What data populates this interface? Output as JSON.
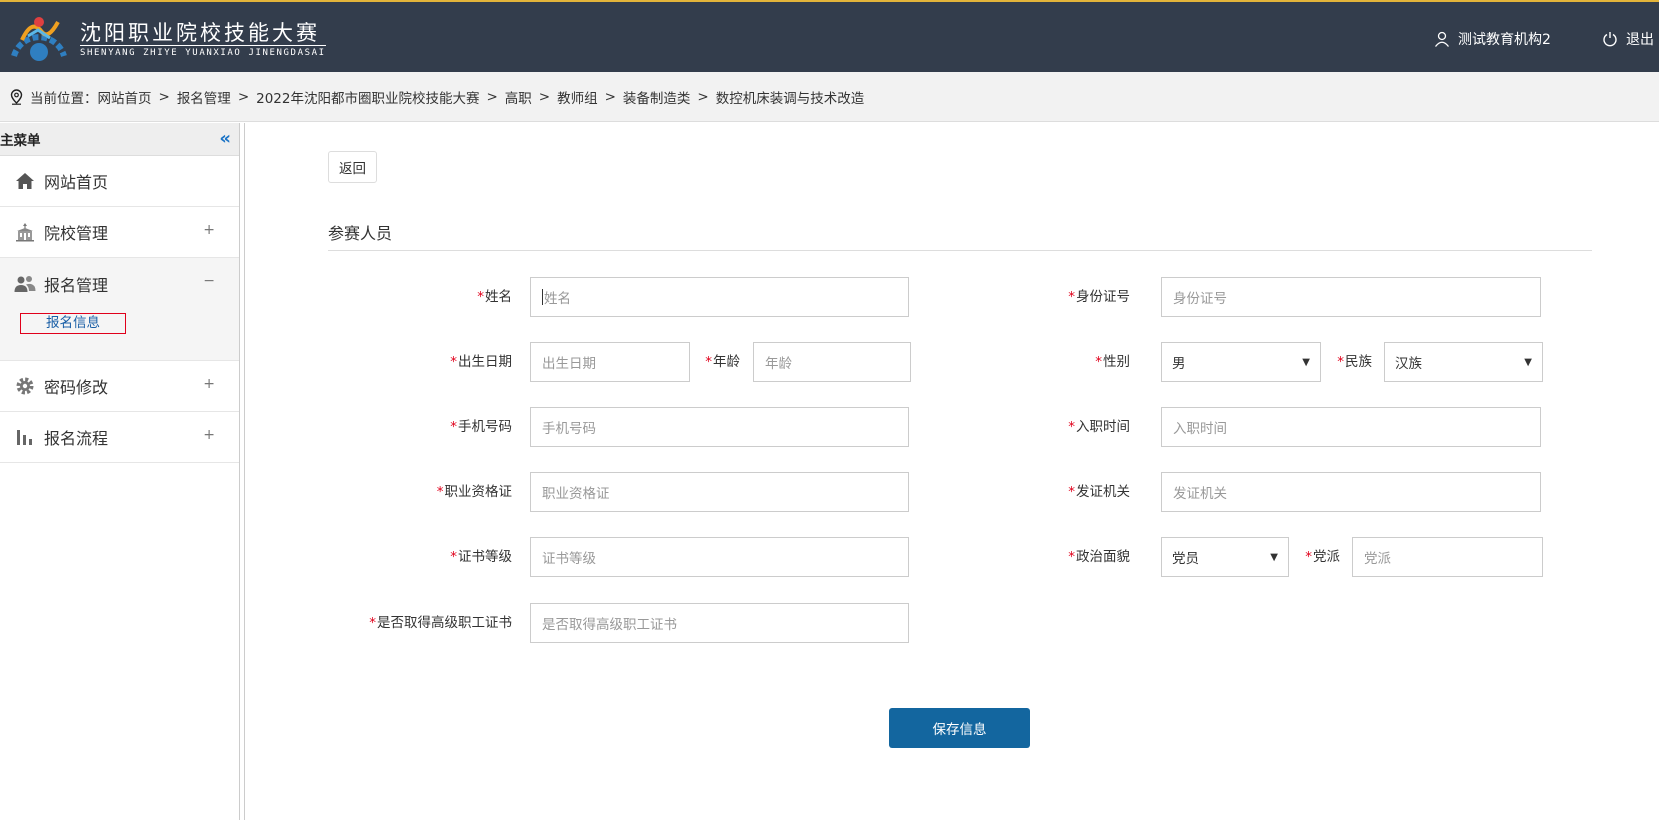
{
  "header": {
    "logo_title": "沈阳职业院校技能大赛",
    "logo_subtitle": "SHENYANG ZHIYE YUANXIAO JINENGDASAI",
    "user_name": "测试教育机构2",
    "logout_label": "退出",
    "accent_color": "#e3b43a",
    "bg_color": "#333d4c"
  },
  "breadcrumb": {
    "prefix": "当前位置：",
    "items": [
      "网站首页",
      "报名管理",
      "2022年沈阳都市圈职业院校技能大赛",
      "高职",
      "教师组",
      "装备制造类",
      "数控机床装调与技术改造"
    ],
    "separator": ">"
  },
  "sidebar": {
    "title": "主菜单",
    "collapse_icon": "«",
    "items": [
      {
        "label": "网站首页",
        "icon": "home-icon",
        "toggle": ""
      },
      {
        "label": "院校管理",
        "icon": "school-icon",
        "toggle": "+"
      },
      {
        "label": "报名管理",
        "icon": "users-icon",
        "toggle": "−",
        "sub": [
          "报名信息"
        ]
      },
      {
        "label": "密码修改",
        "icon": "gear-icon",
        "toggle": "+"
      },
      {
        "label": "报名流程",
        "icon": "bar-chart-icon",
        "toggle": "+"
      }
    ]
  },
  "main": {
    "back_label": "返回",
    "section_title": "参赛人员",
    "save_label": "保存信息",
    "fields": {
      "name": {
        "label": "姓名",
        "placeholder": "姓名"
      },
      "id_card": {
        "label": "身份证号",
        "placeholder": "身份证号"
      },
      "birth": {
        "label": "出生日期",
        "placeholder": "出生日期"
      },
      "age": {
        "label": "年龄",
        "placeholder": "年龄"
      },
      "gender": {
        "label": "性别",
        "value": "男"
      },
      "ethnicity": {
        "label": "民族",
        "value": "汉族"
      },
      "phone": {
        "label": "手机号码",
        "placeholder": "手机号码"
      },
      "hire_date": {
        "label": "入职时间",
        "placeholder": "入职时间"
      },
      "qualification": {
        "label": "职业资格证",
        "placeholder": "职业资格证"
      },
      "issuer": {
        "label": "发证机关",
        "placeholder": "发证机关"
      },
      "cert_level": {
        "label": "证书等级",
        "placeholder": "证书等级"
      },
      "political": {
        "label": "政治面貌",
        "value": "党员"
      },
      "party": {
        "label": "党派",
        "placeholder": "党派"
      },
      "senior_cert": {
        "label": "是否取得高级职工证书",
        "placeholder": "是否取得高级职工证书"
      }
    },
    "required_mark": "*"
  }
}
